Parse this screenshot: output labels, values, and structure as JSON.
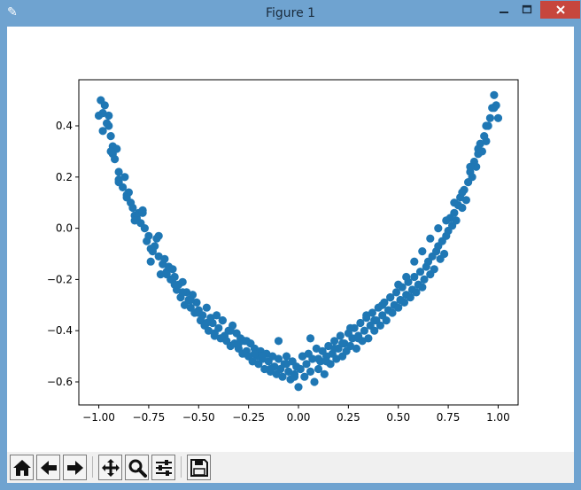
{
  "window": {
    "title": "Figure 1",
    "app_icon": "feather-icon",
    "controls": [
      "minimize-icon",
      "maximize-icon",
      "close-icon"
    ]
  },
  "toolbar": {
    "buttons": [
      "home-icon",
      "back-arrow-icon",
      "forward-arrow-icon",
      "pan-icon",
      "zoom-icon",
      "configure-subplots-icon",
      "save-icon"
    ]
  },
  "colors": {
    "point": "#1f77b4",
    "close_button": "#c7463d",
    "titlebar": "#6fa3d0"
  },
  "chart_data": {
    "type": "scatter",
    "title": "",
    "xlabel": "",
    "ylabel": "",
    "xlim": [
      -1.1,
      1.1
    ],
    "ylim": [
      -0.69,
      0.58
    ],
    "xticks": [
      -1.0,
      -0.75,
      -0.5,
      -0.25,
      0.0,
      0.25,
      0.5,
      0.75,
      1.0
    ],
    "xtick_labels": [
      "−1.00",
      "−0.75",
      "−0.50",
      "−0.25",
      "0.00",
      "0.25",
      "0.50",
      "0.75",
      "1.00"
    ],
    "yticks": [
      -0.6,
      -0.4,
      -0.2,
      0.0,
      0.2,
      0.4
    ],
    "ytick_labels": [
      "−0.6",
      "−0.4",
      "−0.2",
      "0.0",
      "0.2",
      "0.4"
    ],
    "grid": false,
    "legend": "none",
    "series": [
      {
        "x": [
          -1.0,
          -0.99,
          -0.98,
          -0.97,
          -0.96,
          -0.95,
          -0.95,
          -0.94,
          -0.93,
          -0.93,
          -0.92,
          -0.91,
          -0.9,
          -0.9,
          -0.88,
          -0.87,
          -0.86,
          -0.85,
          -0.84,
          -0.83,
          -0.82,
          -0.81,
          -0.8,
          -0.79,
          -0.78,
          -0.77,
          -0.76,
          -0.75,
          -0.74,
          -0.73,
          -0.72,
          -0.71,
          -0.7,
          -0.69,
          -0.68,
          -0.67,
          -0.66,
          -0.65,
          -0.64,
          -0.63,
          -0.62,
          -0.61,
          -0.6,
          -0.59,
          -0.58,
          -0.57,
          -0.56,
          -0.55,
          -0.54,
          -0.53,
          -0.52,
          -0.51,
          -0.5,
          -0.49,
          -0.48,
          -0.47,
          -0.46,
          -0.45,
          -0.44,
          -0.43,
          -0.42,
          -0.41,
          -0.4,
          -0.39,
          -0.38,
          -0.37,
          -0.36,
          -0.35,
          -0.34,
          -0.33,
          -0.32,
          -0.31,
          -0.3,
          -0.29,
          -0.28,
          -0.27,
          -0.26,
          -0.25,
          -0.24,
          -0.23,
          -0.22,
          -0.21,
          -0.2,
          -0.19,
          -0.18,
          -0.17,
          -0.16,
          -0.15,
          -0.14,
          -0.13,
          -0.12,
          -0.11,
          -0.1,
          -0.09,
          -0.08,
          -0.07,
          -0.06,
          -0.05,
          -0.04,
          -0.03,
          -0.02,
          -0.01,
          0.0,
          0.01,
          0.02,
          0.03,
          0.04,
          0.05,
          0.06,
          0.07,
          0.08,
          0.09,
          0.1,
          0.11,
          0.12,
          0.13,
          0.14,
          0.15,
          0.16,
          0.17,
          0.18,
          0.19,
          0.2,
          0.21,
          0.22,
          0.23,
          0.24,
          0.25,
          0.26,
          0.27,
          0.28,
          0.29,
          0.3,
          0.31,
          0.32,
          0.33,
          0.34,
          0.35,
          0.36,
          0.37,
          0.38,
          0.39,
          0.4,
          0.41,
          0.42,
          0.43,
          0.44,
          0.45,
          0.46,
          0.47,
          0.48,
          0.49,
          0.5,
          0.51,
          0.52,
          0.53,
          0.54,
          0.55,
          0.56,
          0.57,
          0.58,
          0.59,
          0.6,
          0.61,
          0.62,
          0.63,
          0.64,
          0.65,
          0.66,
          0.67,
          0.68,
          0.69,
          0.7,
          0.71,
          0.72,
          0.73,
          0.74,
          0.75,
          0.76,
          0.77,
          0.78,
          0.79,
          0.8,
          0.81,
          0.82,
          0.83,
          0.84,
          0.85,
          0.86,
          0.87,
          0.88,
          0.89,
          0.9,
          0.91,
          0.92,
          0.93,
          0.94,
          0.95,
          0.96,
          0.97,
          0.98,
          0.99,
          1.0,
          -0.98,
          -0.94,
          -0.9,
          -0.86,
          -0.82,
          -0.78,
          -0.74,
          -0.7,
          -0.66,
          -0.62,
          -0.58,
          -0.54,
          -0.5,
          -0.46,
          -0.42,
          -0.38,
          -0.34,
          -0.3,
          -0.26,
          -0.22,
          -0.18,
          -0.14,
          -0.1,
          -0.06,
          -0.02,
          0.02,
          0.06,
          0.1,
          0.14,
          0.18,
          0.22,
          0.26,
          0.3,
          0.34,
          0.38,
          0.42,
          0.46,
          0.5,
          0.54,
          0.58,
          0.62,
          0.66,
          0.7,
          0.74,
          0.78,
          0.82,
          0.86,
          0.9,
          0.94,
          0.98
        ],
        "y": [
          0.44,
          0.5,
          0.45,
          0.48,
          0.41,
          0.4,
          0.44,
          0.36,
          0.32,
          0.29,
          0.27,
          0.31,
          0.22,
          0.19,
          0.16,
          0.2,
          0.13,
          0.14,
          0.1,
          0.08,
          0.05,
          0.04,
          0.06,
          0.02,
          0.07,
          0.0,
          -0.05,
          -0.03,
          -0.13,
          -0.09,
          -0.07,
          -0.04,
          -0.11,
          -0.18,
          -0.14,
          -0.12,
          -0.17,
          -0.15,
          -0.2,
          -0.16,
          -0.19,
          -0.24,
          -0.22,
          -0.27,
          -0.21,
          -0.3,
          -0.25,
          -0.28,
          -0.31,
          -0.26,
          -0.33,
          -0.29,
          -0.32,
          -0.36,
          -0.34,
          -0.38,
          -0.31,
          -0.4,
          -0.35,
          -0.37,
          -0.41,
          -0.34,
          -0.39,
          -0.43,
          -0.36,
          -0.42,
          -0.44,
          -0.4,
          -0.46,
          -0.38,
          -0.45,
          -0.41,
          -0.47,
          -0.43,
          -0.49,
          -0.44,
          -0.48,
          -0.5,
          -0.45,
          -0.52,
          -0.47,
          -0.5,
          -0.53,
          -0.48,
          -0.51,
          -0.55,
          -0.49,
          -0.52,
          -0.56,
          -0.5,
          -0.54,
          -0.57,
          -0.51,
          -0.55,
          -0.58,
          -0.53,
          -0.5,
          -0.56,
          -0.59,
          -0.52,
          -0.57,
          -0.54,
          -0.62,
          -0.55,
          -0.5,
          -0.58,
          -0.53,
          -0.49,
          -0.56,
          -0.51,
          -0.6,
          -0.47,
          -0.55,
          -0.52,
          -0.48,
          -0.57,
          -0.5,
          -0.46,
          -0.53,
          -0.49,
          -0.44,
          -0.51,
          -0.47,
          -0.42,
          -0.5,
          -0.45,
          -0.48,
          -0.41,
          -0.46,
          -0.43,
          -0.39,
          -0.47,
          -0.42,
          -0.37,
          -0.44,
          -0.4,
          -0.35,
          -0.43,
          -0.38,
          -0.33,
          -0.4,
          -0.36,
          -0.31,
          -0.38,
          -0.34,
          -0.29,
          -0.36,
          -0.32,
          -0.27,
          -0.33,
          -0.3,
          -0.25,
          -0.31,
          -0.28,
          -0.23,
          -0.29,
          -0.26,
          -0.21,
          -0.27,
          -0.24,
          -0.19,
          -0.25,
          -0.22,
          -0.17,
          -0.23,
          -0.2,
          -0.15,
          -0.13,
          -0.18,
          -0.11,
          -0.16,
          -0.09,
          -0.07,
          -0.12,
          -0.05,
          -0.1,
          -0.03,
          -0.01,
          0.04,
          0.01,
          0.06,
          0.03,
          0.09,
          0.12,
          0.08,
          0.15,
          0.11,
          0.18,
          0.22,
          0.2,
          0.26,
          0.24,
          0.29,
          0.33,
          0.3,
          0.36,
          0.34,
          0.4,
          0.43,
          0.47,
          0.52,
          0.48,
          0.43,
          0.38,
          0.3,
          0.18,
          0.12,
          0.03,
          0.06,
          -0.08,
          -0.03,
          -0.18,
          -0.22,
          -0.25,
          -0.28,
          -0.33,
          -0.37,
          -0.42,
          -0.36,
          -0.4,
          -0.45,
          -0.44,
          -0.49,
          -0.5,
          -0.55,
          -0.44,
          -0.53,
          -0.58,
          -0.5,
          -0.43,
          -0.51,
          -0.52,
          -0.47,
          -0.45,
          -0.39,
          -0.43,
          -0.34,
          -0.36,
          -0.3,
          -0.27,
          -0.22,
          -0.19,
          -0.13,
          -0.09,
          -0.04,
          0.0,
          0.03,
          0.1,
          0.14,
          0.24,
          0.31,
          0.4,
          0.47
        ]
      }
    ]
  }
}
